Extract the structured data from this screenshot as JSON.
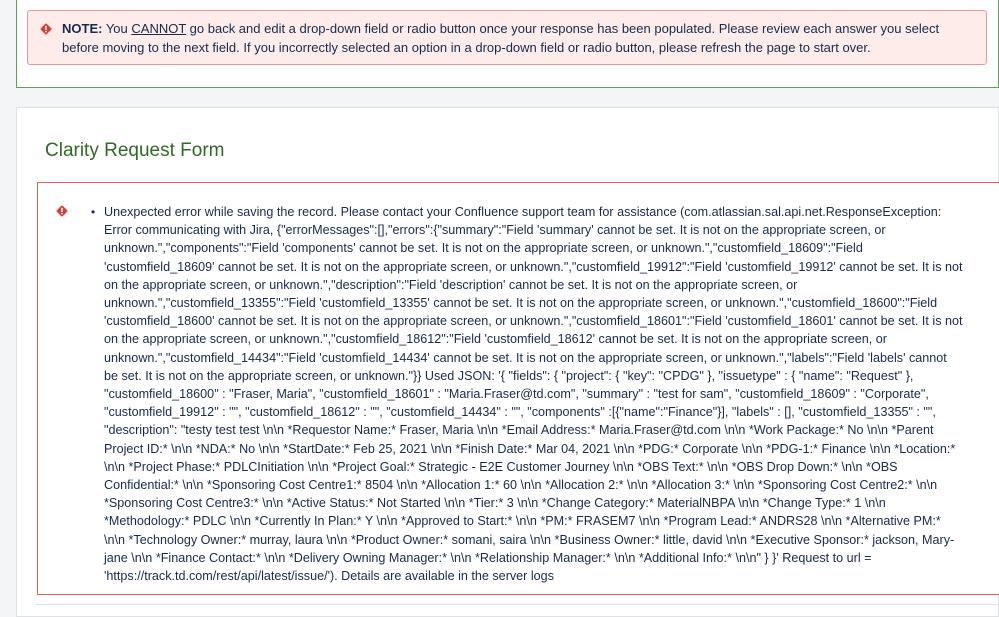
{
  "note": {
    "prefix": "NOTE:",
    "text_before": " You ",
    "emphasis": "CANNOT",
    "text_after": " go back and edit a drop-down field or radio button once your response has been populated. Please review each answer you select before moving to the next field. If you incorrectly selected an option in a drop-down field or radio button, please refresh the page to start over.",
    "icon": "error-diamond-icon"
  },
  "form": {
    "title": "Clarity Request Form"
  },
  "error": {
    "icon": "error-diamond-icon",
    "message": "Unexpected error while saving the record. Please contact your Confluence support team for assistance (com.atlassian.sal.api.net.ResponseException: Error communicating with Jira, {\"errorMessages\":[],\"errors\":{\"summary\":\"Field 'summary' cannot be set. It is not on the appropriate screen, or unknown.\",\"components\":\"Field 'components' cannot be set. It is not on the appropriate screen, or unknown.\",\"customfield_18609\":\"Field 'customfield_18609' cannot be set. It is not on the appropriate screen, or unknown.\",\"customfield_19912\":\"Field 'customfield_19912' cannot be set. It is not on the appropriate screen, or unknown.\",\"description\":\"Field 'description' cannot be set. It is not on the appropriate screen, or unknown.\",\"customfield_13355\":\"Field 'customfield_13355' cannot be set. It is not on the appropriate screen, or unknown.\",\"customfield_18600\":\"Field 'customfield_18600' cannot be set. It is not on the appropriate screen, or unknown.\",\"customfield_18601\":\"Field 'customfield_18601' cannot be set. It is not on the appropriate screen, or unknown.\",\"customfield_18612\":\"Field 'customfield_18612' cannot be set. It is not on the appropriate screen, or unknown.\",\"customfield_14434\":\"Field 'customfield_14434' cannot be set. It is not on the appropriate screen, or unknown.\",\"labels\":\"Field 'labels' cannot be set. It is not on the appropriate screen, or unknown.\"}} Used JSON: '{ \"fields\": { \"project\": { \"key\": \"CPDG\" }, \"issuetype\" : { \"name\": \"Request\" }, \"customfield_18600\" : \"Fraser, Maria\", \"customfield_18601\" : \"Maria.Fraser@td.com\", \"summary\" : \"test for sam\", \"customfield_18609\" : \"Corporate\", \"customfield_19912\" : \"\", \"customfield_18612\" : \"\", \"customfield_14434\" : \"\", \"components\" :[{\"name\":\"Finance\"}], \"labels\" : [], \"customfield_13355\" : \"\", \"description\": \"testy test test \\n\\n *Requestor Name:* Fraser, Maria \\n\\n *Email Address:* Maria.Fraser@td.com \\n\\n *Work Package:* No \\n\\n *Parent Project ID:* \\n\\n *NDA:* No \\n\\n *StartDate:* Feb 25, 2021 \\n\\n *Finish Date:* Mar 04, 2021 \\n\\n *PDG:* Corporate \\n\\n *PDG-1:* Finance \\n\\n *Location:* \\n\\n *Project Phase:* PDLCInitiation \\n\\n *Project Goal:* Strategic - E2E Customer Journey \\n\\n *OBS Text:* \\n\\n *OBS Drop Down:* \\n\\n *OBS Confidential:* \\n\\n *Sponsoring Cost Centre1:* 8504 \\n\\n *Allocation 1:* 60 \\n\\n *Allocation 2:* \\n\\n *Allocation 3:* \\n\\n *Sponsoring Cost Centre2:* \\n\\n *Sponsoring Cost Centre3:* \\n\\n *Active Status:* Not Started \\n\\n *Tier:* 3 \\n\\n *Change Category:* MaterialNBPA \\n\\n *Change Type:* 1 \\n\\n *Methodology:* PDLC \\n\\n *Currently In Plan:* Y \\n\\n *Approved to Start:* \\n\\n *PM:* FRASEM7 \\n\\n *Program Lead:* ANDRS28 \\n\\n *Alternative PM:* \\n\\n *Technology Owner:* murray, laura \\n\\n *Product Owner:* somani, saira \\n\\n *Business Owner:* little, david \\n\\n *Executive Sponsor:* jackson, Mary-jane \\n\\n *Finance Contact:* \\n\\n *Delivery Owning Manager:* \\n\\n *Relationship Manager:* \\n\\n *Additional Info:* \\n\\n\" } }' Request to url = 'https://track.td.com/rest/api/latest/issue/'). Details are available in the server logs"
  },
  "colors": {
    "error_red": "#d04437",
    "title_green": "#2e6b24",
    "panel_border_green": "#5fa35a"
  }
}
